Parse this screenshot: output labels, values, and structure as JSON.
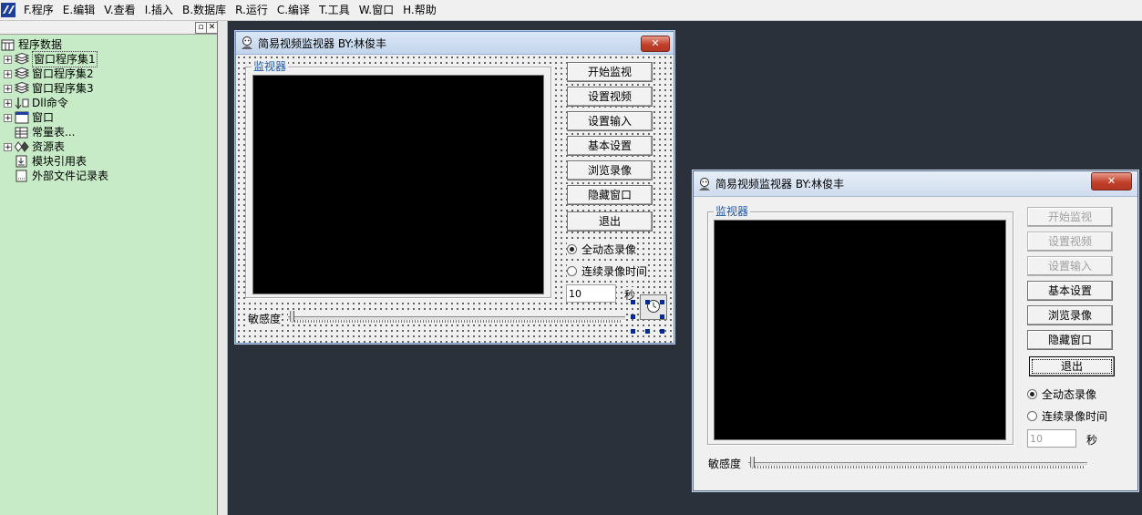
{
  "menu": {
    "items": [
      "F.程序",
      "E.编辑",
      "V.查看",
      "I.插入",
      "B.数据库",
      "R.运行",
      "C.编译",
      "T.工具",
      "W.窗口",
      "H.帮助"
    ]
  },
  "tree": {
    "root": "程序数据",
    "items": [
      {
        "label": "窗口程序集1",
        "icon": "stack-icon",
        "expandable": true,
        "selected": true
      },
      {
        "label": "窗口程序集2",
        "icon": "stack-icon",
        "expandable": true,
        "selected": false
      },
      {
        "label": "窗口程序集3",
        "icon": "stack-icon",
        "expandable": true,
        "selected": false
      },
      {
        "label": "Dll命令",
        "icon": "dll-icon",
        "expandable": true,
        "selected": false
      },
      {
        "label": "窗口",
        "icon": "window-icon",
        "expandable": true,
        "selected": false
      },
      {
        "label": "常量表...",
        "icon": "constant-table-icon",
        "expandable": false,
        "selected": false
      },
      {
        "label": "资源表",
        "icon": "resource-icon",
        "expandable": true,
        "selected": false
      },
      {
        "label": "模块引用表",
        "icon": "module-icon",
        "expandable": false,
        "selected": false
      },
      {
        "label": "外部文件记录表",
        "icon": "file-record-icon",
        "expandable": false,
        "selected": false
      }
    ]
  },
  "designer": {
    "title": "简易视频监视器  BY:林俊丰",
    "group_label": "监视器",
    "buttons": [
      "开始监视",
      "设置视频",
      "设置输入",
      "基本设置",
      "浏览录像",
      "隐藏窗口",
      "退出"
    ],
    "radio_full": "全动态录像",
    "radio_continuous": "连续录像时间",
    "seconds_value": "10",
    "seconds_unit": "秒",
    "sensitivity_label": "敏感度",
    "close_glyph": "✕"
  },
  "preview": {
    "title": "简易视频监视器  BY:林俊丰",
    "group_label": "监视器",
    "buttons": [
      {
        "label": "开始监视",
        "enabled": false
      },
      {
        "label": "设置视频",
        "enabled": false
      },
      {
        "label": "设置输入",
        "enabled": false
      },
      {
        "label": "基本设置",
        "enabled": true
      },
      {
        "label": "浏览录像",
        "enabled": true
      },
      {
        "label": "隐藏窗口",
        "enabled": true
      },
      {
        "label": "退出",
        "enabled": true,
        "focused": true
      }
    ],
    "radio_full": "全动态录像",
    "radio_continuous": "连续录像时间",
    "seconds_value": "10",
    "seconds_unit": "秒",
    "sensitivity_label": "敏感度",
    "close_glyph": "✕"
  },
  "colors": {
    "workspace": "#2b313b",
    "tree_background": "#c6ebc6",
    "group_label": "#1a55a6",
    "video": "#000000",
    "close_button": "#c2402a"
  }
}
